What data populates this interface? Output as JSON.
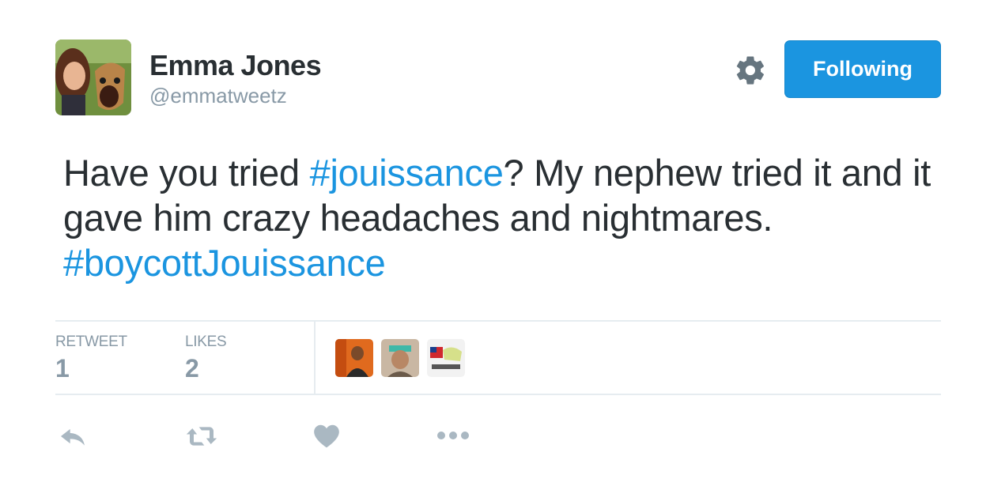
{
  "header": {
    "user_name": "Emma Jones",
    "user_handle": "@emmatweetz",
    "follow_label": "Following",
    "avatar_icon": "user-avatar-photo",
    "settings_icon": "gear-icon"
  },
  "tweet": {
    "text_1": "Have you tried ",
    "hashtag_1": "#jouissance",
    "text_2": "? My nephew tried it and it gave him crazy headaches and nightmares. ",
    "hashtag_2": "#boycottJouissance"
  },
  "stats": {
    "retweets_label": "RETWEET",
    "retweets_count": "1",
    "likes_label": "LIKES",
    "likes_count": "2"
  },
  "likers": [
    {
      "icon": "liker-avatar-1"
    },
    {
      "icon": "liker-avatar-2"
    },
    {
      "icon": "liker-avatar-3"
    }
  ],
  "actions": {
    "reply_icon": "reply-icon",
    "retweet_icon": "retweet-icon",
    "like_icon": "heart-icon",
    "more_icon": "more-dots-icon"
  },
  "colors": {
    "link": "#1b95e0",
    "muted": "#8899a6",
    "text": "#292f33",
    "divider": "#e6ecf0",
    "action_icon": "#aab8c2"
  }
}
